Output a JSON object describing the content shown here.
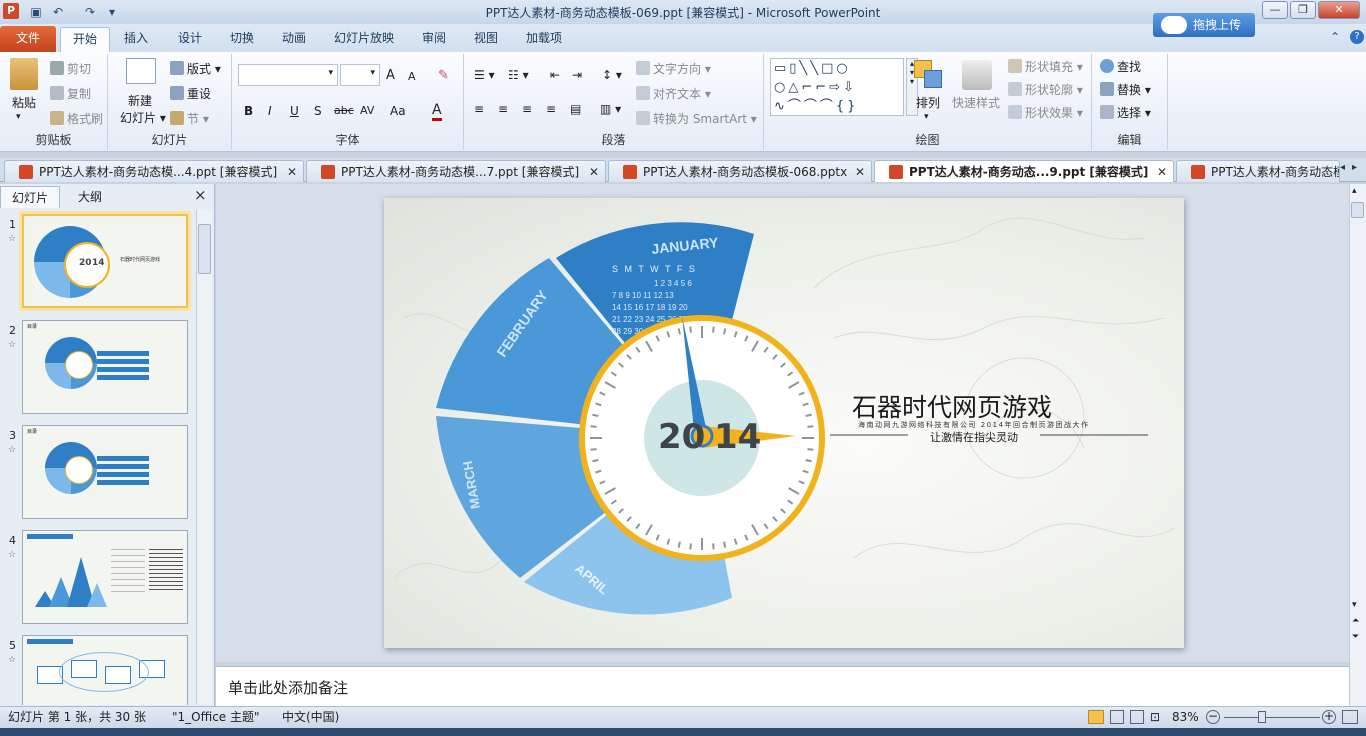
{
  "window": {
    "title": "PPT达人素材-商务动态模板-069.ppt [兼容模式]  -  Microsoft PowerPoint",
    "app_icon": "P",
    "upload_label": "拖拽上传"
  },
  "ribbon_tabs": [
    "文件",
    "开始",
    "插入",
    "设计",
    "切换",
    "动画",
    "幻灯片放映",
    "审阅",
    "视图",
    "加载项"
  ],
  "ribbon": {
    "clipboard": {
      "group": "剪贴板",
      "paste": "粘贴",
      "cut": "剪切",
      "copy": "复制",
      "format_painter": "格式刷"
    },
    "slides": {
      "group": "幻灯片",
      "new_slide_1": "新建",
      "new_slide_2": "幻灯片",
      "layout": "版式",
      "reset": "重设",
      "section": "节"
    },
    "font": {
      "group": "字体",
      "grow": "A",
      "shrink": "A",
      "bold": "B",
      "italic": "I",
      "underline": "U",
      "shadow": "S",
      "strike": "abc",
      "spacing": "AV",
      "case": "Aa",
      "color": "A"
    },
    "paragraph": {
      "group": "段落",
      "text_direction": "文字方向",
      "align_text": "对齐文本",
      "smartart": "转换为 SmartArt"
    },
    "drawing": {
      "group": "绘图",
      "arrange": "排列",
      "quick_styles": "快速样式",
      "shape_fill": "形状填充",
      "shape_outline": "形状轮廓",
      "shape_effects": "形状效果"
    },
    "editing": {
      "group": "编辑",
      "find": "查找",
      "replace": "替换",
      "select": "选择"
    }
  },
  "doc_tabs": [
    {
      "label": "PPT达人素材-商务动态模...4.ppt [兼容模式]",
      "active": false
    },
    {
      "label": "PPT达人素材-商务动态模...7.ppt [兼容模式]",
      "active": false
    },
    {
      "label": "PPT达人素材-商务动态模板-068.pptx",
      "active": false
    },
    {
      "label": "PPT达人素材-商务动态...9.ppt [兼容模式]",
      "active": true
    },
    {
      "label": "PPT达人素材-商务动态模",
      "active": false
    }
  ],
  "panel": {
    "tab_slides": "幻灯片",
    "tab_outline": "大纲",
    "close": "×"
  },
  "thumbs": [
    {
      "num": "1",
      "star": "☆",
      "title": "石器时代网页游戏"
    },
    {
      "num": "2",
      "star": "☆",
      "title": "目录"
    },
    {
      "num": "3",
      "star": "☆",
      "title": "目录"
    },
    {
      "num": "4",
      "star": "☆",
      "title": ""
    },
    {
      "num": "5",
      "star": "☆",
      "title": ""
    }
  ],
  "slide": {
    "months": {
      "jan": "JANUARY",
      "feb": "FEBRUARY",
      "mar": "MARCH",
      "apr": "APRIL"
    },
    "weekdays": "S M T W T F S",
    "year_a": "20",
    "year_b": "14",
    "title": "石器时代网页游戏",
    "small_line": "海南动网九游网络科技有限公司 2014年回合制页游团战大作",
    "subtitle": "让激情在指尖灵动",
    "accent": "#f2b21b",
    "blue_dark": "#2f7fc6",
    "blue_mid": "#4a98d8",
    "blue_light": "#7cb9ea"
  },
  "notes_placeholder": "单击此处添加备注",
  "status": {
    "slide_info": "幻灯片 第 1 张，共 30 张",
    "theme": "\"1_Office 主题\"",
    "language": "中文(中国)",
    "zoom": "83%"
  }
}
